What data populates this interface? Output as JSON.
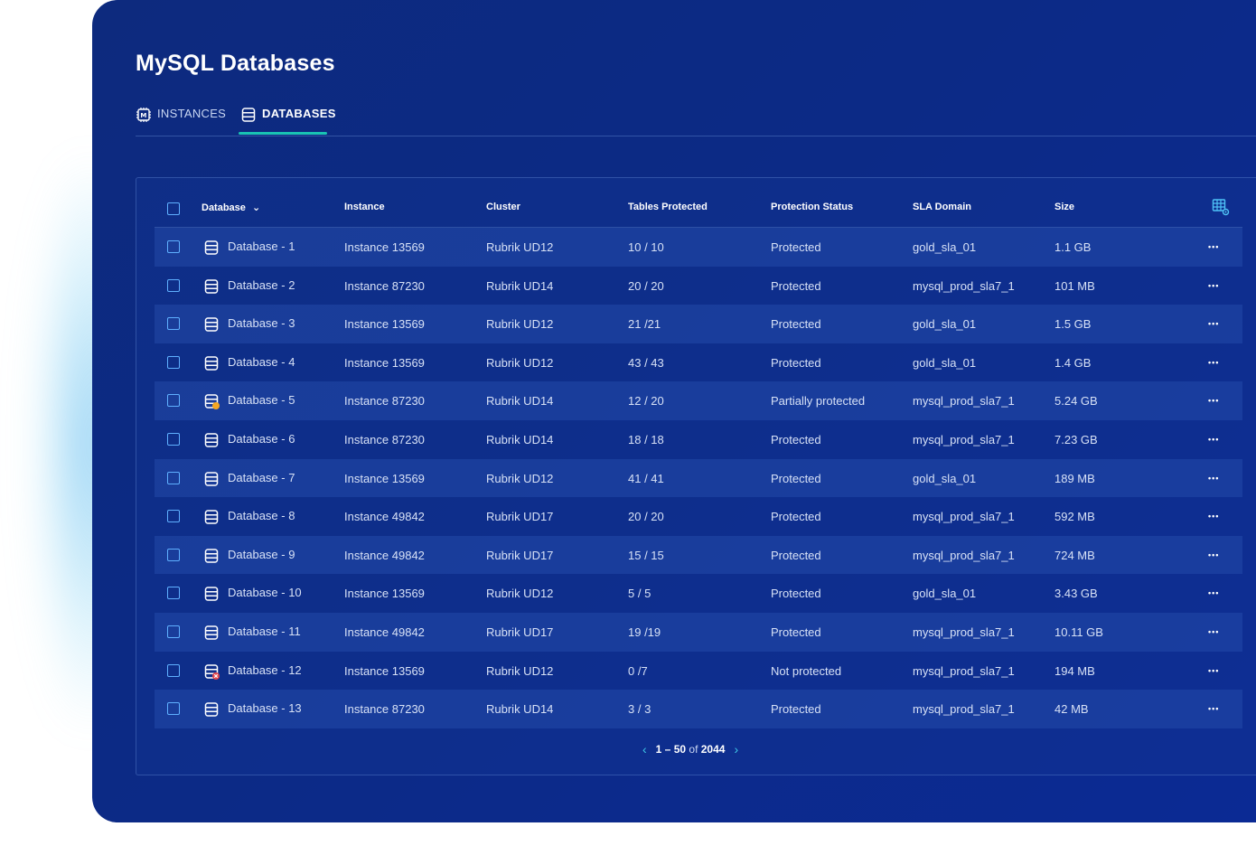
{
  "page": {
    "title": "MySQL Databases"
  },
  "tabs": [
    {
      "label": "INSTANCES",
      "active": false
    },
    {
      "label": "DATABASES",
      "active": true
    }
  ],
  "table": {
    "columns": [
      "Database",
      "Instance",
      "Cluster",
      "Tables Protected",
      "Protection Status",
      "SLA Domain",
      "Size"
    ],
    "sort_indicator": "⌄",
    "rows": [
      {
        "database": "Database - 1",
        "instance": "Instance 13569",
        "cluster": "Rubrik UD12",
        "tables": "10 / 10",
        "status": "Protected",
        "sla": "gold_sla_01",
        "size": "1.1 GB",
        "icon": "database-icon"
      },
      {
        "database": "Database - 2",
        "instance": "Instance 87230",
        "cluster": "Rubrik UD14",
        "tables": "20 / 20",
        "status": "Protected",
        "sla": "mysql_prod_sla7_1",
        "size": "101 MB",
        "icon": "database-icon"
      },
      {
        "database": "Database - 3",
        "instance": "Instance 13569",
        "cluster": "Rubrik UD12",
        "tables": "21 /21",
        "status": "Protected",
        "sla": "gold_sla_01",
        "size": "1.5 GB",
        "icon": "database-icon"
      },
      {
        "database": "Database - 4",
        "instance": "Instance 13569",
        "cluster": "Rubrik UD12",
        "tables": "43 / 43",
        "status": "Protected",
        "sla": "gold_sla_01",
        "size": "1.4 GB",
        "icon": "database-icon"
      },
      {
        "database": "Database - 5",
        "instance": "Instance 87230",
        "cluster": "Rubrik UD14",
        "tables": "12 / 20",
        "status": "Partially protected",
        "sla": "mysql_prod_sla7_1",
        "size": "5.24 GB",
        "icon": "database-warning-icon"
      },
      {
        "database": "Database - 6",
        "instance": "Instance 87230",
        "cluster": "Rubrik UD14",
        "tables": "18 / 18",
        "status": "Protected",
        "sla": "mysql_prod_sla7_1",
        "size": "7.23 GB",
        "icon": "database-icon"
      },
      {
        "database": "Database - 7",
        "instance": "Instance 13569",
        "cluster": "Rubrik UD12",
        "tables": "41 / 41",
        "status": "Protected",
        "sla": "gold_sla_01",
        "size": "189 MB",
        "icon": "database-icon"
      },
      {
        "database": "Database - 8",
        "instance": "Instance 49842",
        "cluster": "Rubrik UD17",
        "tables": "20 / 20",
        "status": "Protected",
        "sla": "mysql_prod_sla7_1",
        "size": "592 MB",
        "icon": "database-icon"
      },
      {
        "database": "Database - 9",
        "instance": "Instance 49842",
        "cluster": "Rubrik UD17",
        "tables": "15 / 15",
        "status": "Protected",
        "sla": "mysql_prod_sla7_1",
        "size": "724 MB",
        "icon": "database-icon"
      },
      {
        "database": "Database - 10",
        "instance": "Instance 13569",
        "cluster": "Rubrik UD12",
        "tables": "5 / 5",
        "status": "Protected",
        "sla": "gold_sla_01",
        "size": "3.43 GB",
        "icon": "database-icon"
      },
      {
        "database": "Database - 11",
        "instance": "Instance 49842",
        "cluster": "Rubrik UD17",
        "tables": "19 /19",
        "status": "Protected",
        "sla": "mysql_prod_sla7_1",
        "size": "10.11 GB",
        "icon": "database-icon"
      },
      {
        "database": "Database - 12",
        "instance": "Instance 13569",
        "cluster": "Rubrik UD12",
        "tables": "0 /7",
        "status": "Not protected",
        "sla": "mysql_prod_sla7_1",
        "size": "194 MB",
        "icon": "database-error-icon"
      },
      {
        "database": "Database - 13",
        "instance": "Instance 87230",
        "cluster": "Rubrik UD14",
        "tables": "3 / 3",
        "status": "Protected",
        "sla": "mysql_prod_sla7_1",
        "size": "42 MB",
        "icon": "database-icon"
      }
    ]
  },
  "pagination": {
    "range": "1 – 50",
    "of_label": "of",
    "total": "2044"
  },
  "colors": {
    "accent": "#19c3b3",
    "warning": "#f5a623",
    "error": "#e5484d",
    "checkbox": "#5fb0ff"
  }
}
